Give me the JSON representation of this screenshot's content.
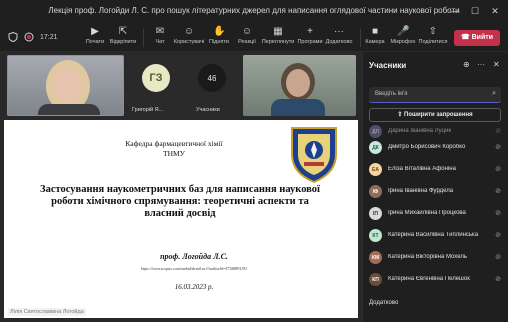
{
  "window": {
    "title": "Лекція проф. Логойди Л. С. про пошук літературних джерел для написання оглядової частини наукової роботи",
    "minimize": "—",
    "maximize": "☐",
    "close": "✕"
  },
  "toolbar": {
    "timer": "17:21",
    "items": [
      {
        "label": "Почати",
        "icon": "▶"
      },
      {
        "label": "Відкріпити",
        "icon": "⇱"
      },
      {
        "label": "Чат",
        "icon": "✉"
      },
      {
        "label": "Користувачі",
        "icon": "☺"
      },
      {
        "label": "Підняти",
        "icon": "✋"
      },
      {
        "label": "Реакції",
        "icon": "☺"
      },
      {
        "label": "Переглянути",
        "icon": "▦"
      },
      {
        "label": "Програми",
        "icon": "+"
      },
      {
        "label": "Додатково",
        "icon": "···"
      },
      {
        "label": "Камера",
        "icon": "■"
      },
      {
        "label": "Мікрофон",
        "icon": "🎤"
      },
      {
        "label": "Поділитися",
        "icon": "⇧"
      }
    ],
    "leave_label": "Вийти"
  },
  "stage": {
    "tiles": [
      {
        "initials": "ГЗ",
        "name": "Григорій Я..."
      },
      {
        "count": "46",
        "label": "Учасники"
      }
    ],
    "speaker_label": "Лілія Святославівна Логойда"
  },
  "slide": {
    "dept_line1": "Кафедра фармацевтичної хімії",
    "dept_line2": "ТНМУ",
    "heading_line1": "Застосування наукометричних баз для написання наукової",
    "heading_line2": "роботи хімічного спрямування: теоретичні аспекти та",
    "heading_line3": "власний досвід",
    "author": "проф. Логойда Л.С.",
    "url": "https://www.scopus.com/authid/detail.uri?authorId=57188891191",
    "date": "16.03.2023 р."
  },
  "panel": {
    "title": "Учасники",
    "search_placeholder": "Введіть ім'я",
    "share_label": "Поширити запрошення",
    "participants": [
      {
        "name": "Дарина Іванівна Луцик",
        "initials": "ДЛ",
        "color": "#7b6fb0"
      },
      {
        "name": "Дмитро Борисович Коробко",
        "initials": "ДК",
        "color": "#c9e7df"
      },
      {
        "name": "Еліза Віталівна Афоніна",
        "initials": "ЕА",
        "color": "#f5d6a3"
      },
      {
        "name": "Ірина Іванівна Фурдела",
        "initials": "ІФ",
        "color": "#8f6d5e"
      },
      {
        "name": "Ірина Михайлівна Процкова",
        "initials": "ІП",
        "color": "#d9d9d9"
      },
      {
        "name": "Катерина Василівна Типлинська",
        "initials": "КТ",
        "color": "#bfe6cf"
      },
      {
        "name": "Катерина Вікторівна Мохель",
        "initials": "КМ",
        "color": "#a46c52"
      },
      {
        "name": "Катерина Євгенівна Пелешок",
        "initials": "КП",
        "color": "#6b4d3b"
      }
    ],
    "section_label": "Додатково"
  }
}
